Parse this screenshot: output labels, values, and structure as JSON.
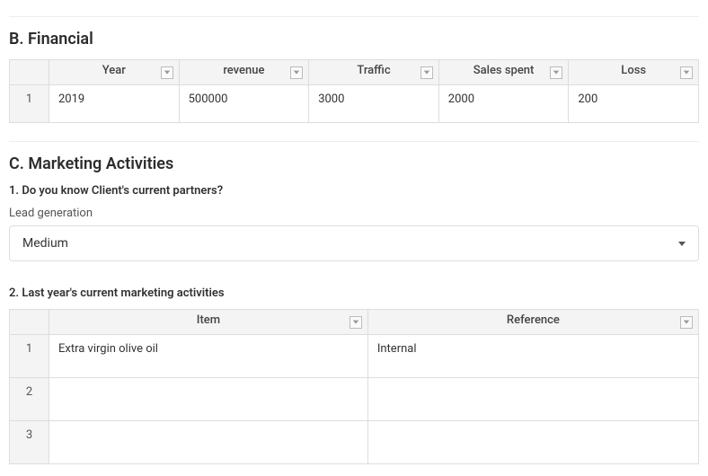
{
  "section_b": {
    "title": "B. Financial",
    "columns": [
      "Year",
      "revenue",
      "Traffic",
      "Sales spent",
      "Loss"
    ],
    "rows": [
      {
        "num": "1",
        "cells": [
          "2019",
          "500000",
          "3000",
          "2000",
          "200"
        ]
      }
    ]
  },
  "section_c": {
    "title": "C. Marketing Activities",
    "q1": {
      "question": "1. Do you know Client's current partners?",
      "label": "Lead generation",
      "selected": "Medium"
    },
    "q2": {
      "question": "2. Last year's current marketing activities",
      "columns": [
        "Item",
        "Reference"
      ],
      "rows": [
        {
          "num": "1",
          "cells": [
            "Extra virgin olive oil",
            "Internal"
          ]
        },
        {
          "num": "2",
          "cells": [
            "",
            ""
          ]
        },
        {
          "num": "3",
          "cells": [
            "",
            ""
          ]
        }
      ]
    }
  }
}
